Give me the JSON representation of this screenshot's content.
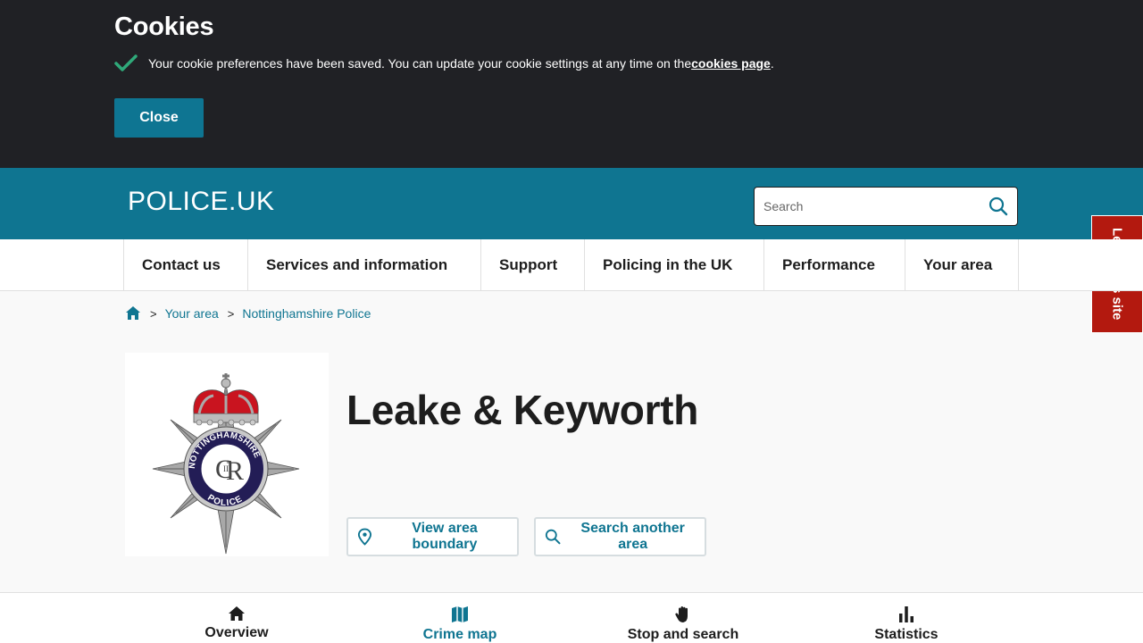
{
  "cookie_banner": {
    "title": "Cookies",
    "message": "Your cookie preferences have been saved. You can update your cookie settings at any time on the ",
    "link_text": "cookies page",
    "message_end": ".",
    "close_label": "Close"
  },
  "header": {
    "logo_text": "POLICE.UK",
    "search_placeholder": "Search",
    "search_icon": "search-icon"
  },
  "leave_site": {
    "label": "Leave this site"
  },
  "nav": {
    "items": [
      {
        "label": "Contact us"
      },
      {
        "label": "Services and information"
      },
      {
        "label": "Support"
      },
      {
        "label": "Policing in the UK"
      },
      {
        "label": "Performance"
      },
      {
        "label": "Your area"
      }
    ]
  },
  "breadcrumb": {
    "home_icon": "home-icon",
    "items": [
      {
        "label": "Your area"
      },
      {
        "label": "Nottinghamshire Police"
      }
    ]
  },
  "force": {
    "logo_icon": "nottinghamshire-police-crest",
    "logo_text": "NOTTINGHAMSHIRE POLICE"
  },
  "page": {
    "title": "Leake & Keyworth"
  },
  "actions": {
    "view_boundary": {
      "label": "View area boundary",
      "icon": "map-pin-icon"
    },
    "search_area": {
      "label": "Search another area",
      "icon": "search-icon"
    }
  },
  "tabs": [
    {
      "label": "Overview",
      "icon": "home-icon",
      "active": false
    },
    {
      "label": "Crime map",
      "icon": "map-icon",
      "active": true
    },
    {
      "label": "Stop and search",
      "icon": "hand-icon",
      "active": false
    },
    {
      "label": "Statistics",
      "icon": "bar-chart-icon",
      "active": false
    }
  ],
  "colors": {
    "banner_bg": "#202125",
    "brand_teal": "#0f7591",
    "leave_red": "#b3190f",
    "check_green": "#2fa97a"
  }
}
